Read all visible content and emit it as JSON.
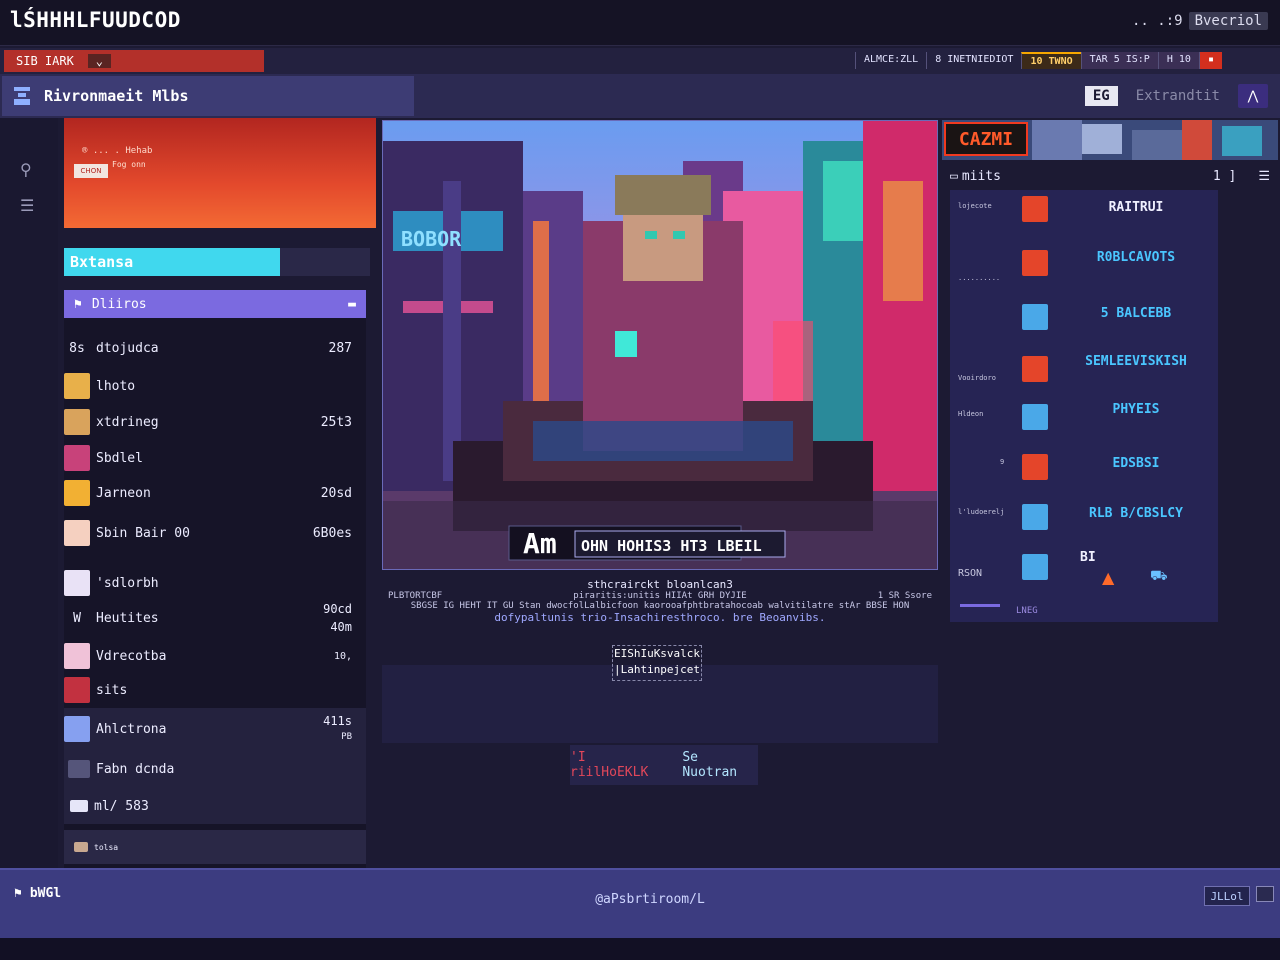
{
  "window": {
    "app_title": "lŚHHHLFUUDCOD",
    "status": ".. .:9",
    "status_chip": "Bvecriol"
  },
  "tabs": {
    "active_label": "SIB IARK",
    "links": [
      "ALMCE:ZLL",
      "8 INETNIEDIOT",
      "10 TWNO",
      "TAR 5 IS:P",
      "H 10"
    ]
  },
  "header": {
    "title": "Rivronmaeit Mlbs",
    "badge": "EG",
    "user": "Extrandtit"
  },
  "promo": {
    "line1": "® ... . Hehab",
    "badge": "CHON",
    "line2": "Fog onn"
  },
  "sidebar": {
    "status_label": "Bxtansa",
    "section_label": "Dliiros",
    "items": [
      {
        "label": "dtojudca",
        "prefix": "8s",
        "value": "287",
        "thumb": "#2a2848"
      },
      {
        "label": "lhoto",
        "value": "",
        "thumb": "#e8b04a"
      },
      {
        "label": "xtdrineg",
        "value": "25t3",
        "thumb": "#d9a35c"
      },
      {
        "label": "Sbdlel",
        "value": "",
        "thumb": "#c8427a"
      },
      {
        "label": "Jarneon",
        "value": "20sd",
        "thumb": "#f2b033"
      },
      {
        "label": "Sbin Bair 00",
        "value": "6B0es",
        "thumb": "#f5d0c0"
      },
      {
        "label": "'sdlorbh",
        "value": "",
        "thumb": "#e9e2f6"
      },
      {
        "label": "Heutites",
        "prefix": "W",
        "value": "90cd",
        "value2": "40m",
        "thumb": "#1f1d36"
      },
      {
        "label": "Vdrecotba",
        "value": "10,",
        "thumb": "#f0c2d8"
      },
      {
        "label": "sits",
        "value": "",
        "thumb": "#c23140"
      },
      {
        "label": "Ahlctrona",
        "value": "411s",
        "value2": "PB",
        "thumb": "#86a0f0"
      },
      {
        "label": "Fabn dcnda",
        "value": "",
        "thumb": "#55557a"
      },
      {
        "label": "ml/ 583",
        "value": "",
        "thumb": "#e6e6f8"
      },
      {
        "label": "tolsa",
        "value": "",
        "thumb": "#c8a890"
      }
    ]
  },
  "main": {
    "banner_text": "Am",
    "banner_sign": "OHN HOHIS3 HT3 LBEIL",
    "side_sign": "BOBOR",
    "caption_line1": "sthcrairckt bloanlcan3",
    "caption_left": "PLBTORTCBF",
    "caption_mid": "piraritis:unitis HIIAt GRH DYJIE",
    "caption_right": "1 SR Ssore",
    "caption_line3": "SBGSE IG HEHT IT GU Stan dwocfolLalbicfoon kaorooafphtbratahocoab walvitilatre stAr BBSE HON",
    "caption_line4": "dofypaltunis trio-Insachiresthroco. bre Beoanvibs.",
    "boxed_line1": "EIShIuKsvalck",
    "boxed_line2": "|Lahtinpejcet",
    "action1": "'I riilHoEKLK",
    "action2": "Se Nuotran"
  },
  "rightpanel": {
    "logo": "CAZMI",
    "head_label": "miits",
    "head_mid": "1 ]",
    "rows": [
      {
        "sub": "lojecote",
        "label": "RAITRUI",
        "color": "#f0f0ff",
        "icon": "#e4452a"
      },
      {
        "sub": "..........",
        "label": "R0BLCAVOTS",
        "color": "#4ac6ff",
        "icon": "#e4452a"
      },
      {
        "sub": "",
        "label": "5 BALCEBB",
        "color": "#4ac6ff",
        "icon": "#4aa8e8"
      },
      {
        "sub": "Vooirdoro",
        "label": "SEMLEEVISKISH",
        "color": "#4ac6ff",
        "icon": "#e4452a"
      },
      {
        "sub": "Hldeon",
        "label": "PHYEIS",
        "color": "#4ac6ff",
        "icon": "#4aa8e8"
      },
      {
        "sub": "9",
        "label": "EDSBSI",
        "color": "#4ac6ff",
        "icon": "#e4452a"
      },
      {
        "sub": "l'ludoerelj",
        "label": "RLB B/CBSLCY",
        "color": "#4ac6ff",
        "icon": "#4aa8e8"
      },
      {
        "sub": "RSON",
        "label": "BI",
        "color": "#f0f0ff",
        "icon": "#4aa8e8"
      }
    ],
    "footer_text": "LNEG"
  },
  "footer": {
    "left_label": "bWGl",
    "center_text": "@aPsbrtiroom/L",
    "button_label": "JLLol"
  },
  "colors": {
    "accent_purple": "#7b6ae0",
    "accent_cyan": "#40d8ee",
    "accent_red": "#b3302a",
    "panel_bg": "#262454"
  }
}
